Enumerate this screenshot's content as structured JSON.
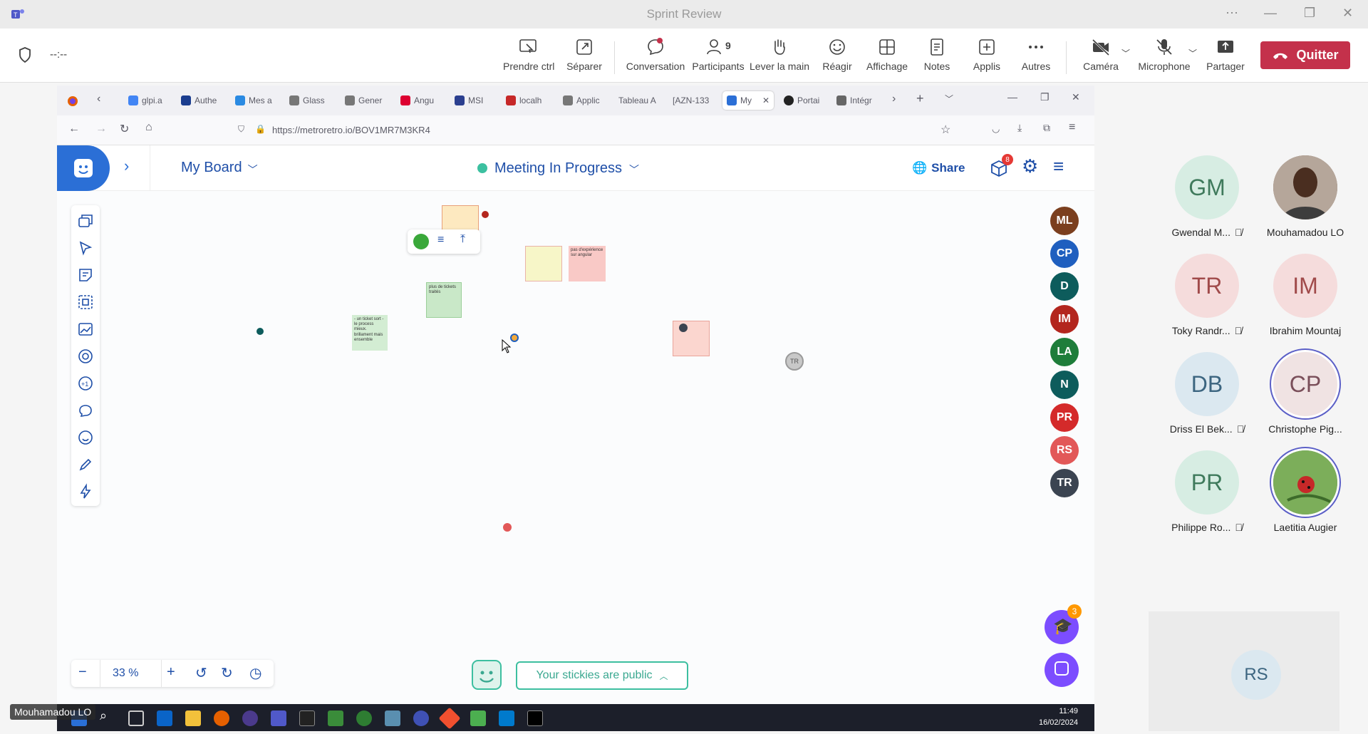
{
  "teams": {
    "window_title": "Sprint Review",
    "timer": "--:--",
    "toolbar": [
      {
        "id": "take-control",
        "label": "Prendre ctrl",
        "icon": "take-control-icon"
      },
      {
        "id": "pop-out",
        "label": "Séparer",
        "icon": "pop-out-icon"
      },
      {
        "id": "chat",
        "label": "Conversation",
        "icon": "chat-icon"
      },
      {
        "id": "participants",
        "label": "Participants",
        "count": "9",
        "icon": "people-icon"
      },
      {
        "id": "raise-hand",
        "label": "Lever la main",
        "icon": "hand-icon"
      },
      {
        "id": "react",
        "label": "Réagir",
        "icon": "smiley-icon"
      },
      {
        "id": "view",
        "label": "Affichage",
        "icon": "grid-icon"
      },
      {
        "id": "notes",
        "label": "Notes",
        "icon": "notes-icon"
      },
      {
        "id": "apps",
        "label": "Applis",
        "icon": "add-icon"
      },
      {
        "id": "more",
        "label": "Autres",
        "icon": "more-icon"
      },
      {
        "id": "camera",
        "label": "Caméra",
        "icon": "camera-off-icon"
      },
      {
        "id": "mic",
        "label": "Microphone",
        "icon": "mic-off-icon"
      },
      {
        "id": "share",
        "label": "Partager",
        "icon": "share-icon"
      }
    ],
    "quit_label": "Quitter",
    "self_label": "Mouhamadou LO",
    "participants": [
      {
        "initials": "GM",
        "name": "Gwendal M...",
        "muted": true,
        "bg": "#d7ede3",
        "fg": "#3f7a5c"
      },
      {
        "initials": "",
        "name": "Mouhamadou LO",
        "muted": false,
        "bg": "#7a5a45",
        "fg": "#fff",
        "photo": true
      },
      {
        "initials": "TR",
        "name": "Toky Randr...",
        "muted": true,
        "bg": "#f5dcdc",
        "fg": "#a04a4a"
      },
      {
        "initials": "IM",
        "name": "Ibrahim Mountaj",
        "muted": false,
        "bg": "#f5dcdc",
        "fg": "#a04a4a"
      },
      {
        "initials": "DB",
        "name": "Driss El Bek...",
        "muted": true,
        "bg": "#dbe8f0",
        "fg": "#3c6580"
      },
      {
        "initials": "CP",
        "name": "Christophe Pig...",
        "muted": false,
        "bg": "#f0e3e3",
        "fg": "#7a4f5a",
        "speaking": true
      },
      {
        "initials": "PR",
        "name": "Philippe Ro...",
        "muted": true,
        "bg": "#d7ede3",
        "fg": "#3f7a5c"
      },
      {
        "initials": "",
        "name": "Laetitia Augier",
        "muted": false,
        "bg": "#6aa05a",
        "fg": "#fff",
        "photo": true,
        "speaking": true
      }
    ],
    "rs_tile": "RS"
  },
  "browser": {
    "tabs": [
      "glpi.a",
      "Authe",
      "Mes a",
      "Glass",
      "Gener",
      "Angu",
      "MSI",
      "localh",
      "Applic",
      "Tableau A",
      "[AZN-133",
      "My",
      "Portai",
      "Intégr"
    ],
    "url": "https://metroretro.io/BOV1MR7M3KR4"
  },
  "metroretro": {
    "board_name": "My Board",
    "status": "Meeting In Progress",
    "share_label": "Share",
    "notif_count": "8",
    "chat_badge": "3",
    "zoom": "33 %",
    "public_label": "Your stickies are public",
    "users": [
      {
        "initials": "ML",
        "color": "#7b3f1e"
      },
      {
        "initials": "CP",
        "color": "#1f5fbf"
      },
      {
        "initials": "D",
        "color": "#0d5c5c"
      },
      {
        "initials": "IM",
        "color": "#b3261e"
      },
      {
        "initials": "LA",
        "color": "#1e7d3a"
      },
      {
        "initials": "N",
        "color": "#0d5c5c"
      },
      {
        "initials": "PR",
        "color": "#d42a2a"
      },
      {
        "initials": "RS",
        "color": "#e25858"
      },
      {
        "initials": "TR",
        "color": "#3b4451"
      }
    ],
    "stickies": {
      "s1": "pas d'expérience sur angular",
      "s2": "plus de tickets traités",
      "s3": "- un ticket sort - le process mieux. brillament mais ensemble"
    },
    "cursor_tag": "TR"
  },
  "taskbar": {
    "time": "11:49",
    "date": "16/02/2024"
  }
}
